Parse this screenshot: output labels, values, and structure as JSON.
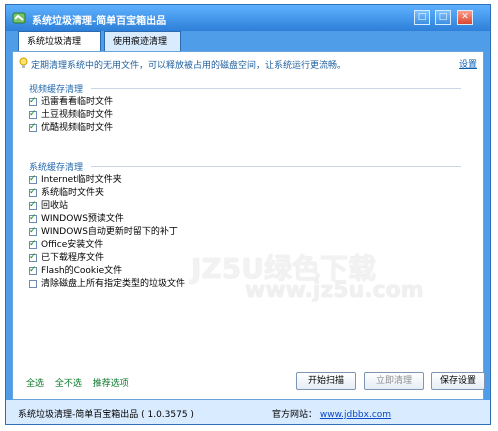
{
  "window": {
    "title": "系统垃圾清理-简单百宝箱出品",
    "controls": {
      "minimize": "□",
      "maximize": "□",
      "close": "✕"
    }
  },
  "tabs": [
    {
      "label": "系统垃圾清理",
      "active": true
    },
    {
      "label": "使用痕迹清理",
      "active": false
    }
  ],
  "tip": {
    "icon": "lightbulb-icon",
    "text": "定期清理系统中的无用文件，可以释放被占用的磁盘空间，让系统运行更流畅。",
    "settings_link": "设置"
  },
  "groups": {
    "video_cache": {
      "title": "视频缓存清理",
      "items": [
        {
          "label": "迅雷看看临时文件",
          "checked": true
        },
        {
          "label": "土豆视频临时文件",
          "checked": true
        },
        {
          "label": "优酷视频临时文件",
          "checked": true
        }
      ]
    },
    "system_cache": {
      "title": "系统缓存清理",
      "items": [
        {
          "label": "Internet临时文件夹",
          "checked": true
        },
        {
          "label": "系统临时文件夹",
          "checked": true
        },
        {
          "label": "回收站",
          "checked": true
        },
        {
          "label": "WINDOWS预读文件",
          "checked": true
        },
        {
          "label": "WINDOWS自动更新时留下的补丁",
          "checked": true
        },
        {
          "label": "Office安装文件",
          "checked": true
        },
        {
          "label": "已下载程序文件",
          "checked": true
        },
        {
          "label": "Flash的Cookie文件",
          "checked": true
        },
        {
          "label": "清除磁盘上所有指定类型的垃圾文件",
          "checked": false
        }
      ]
    }
  },
  "footer_links": {
    "select_all": "全选",
    "select_none": "全不选",
    "recommended": "推荐选项"
  },
  "buttons": {
    "scan": "开始扫描",
    "clean": "立即清理",
    "save": "保存设置"
  },
  "status": {
    "left": "系统垃圾清理-简单百宝箱出品 ( 1.0.3575 )",
    "website_label": "官方网站：",
    "website_url": "www.jdbbx.com"
  },
  "watermark": {
    "line1": "JZ5U绿色下载",
    "line2": "www.jz5u.com"
  },
  "colors": {
    "titlebar": "#2d7fd8",
    "tab_inactive": "#d9ebff",
    "link_green": "#0c7a2a",
    "link_blue": "#0a49c8"
  }
}
